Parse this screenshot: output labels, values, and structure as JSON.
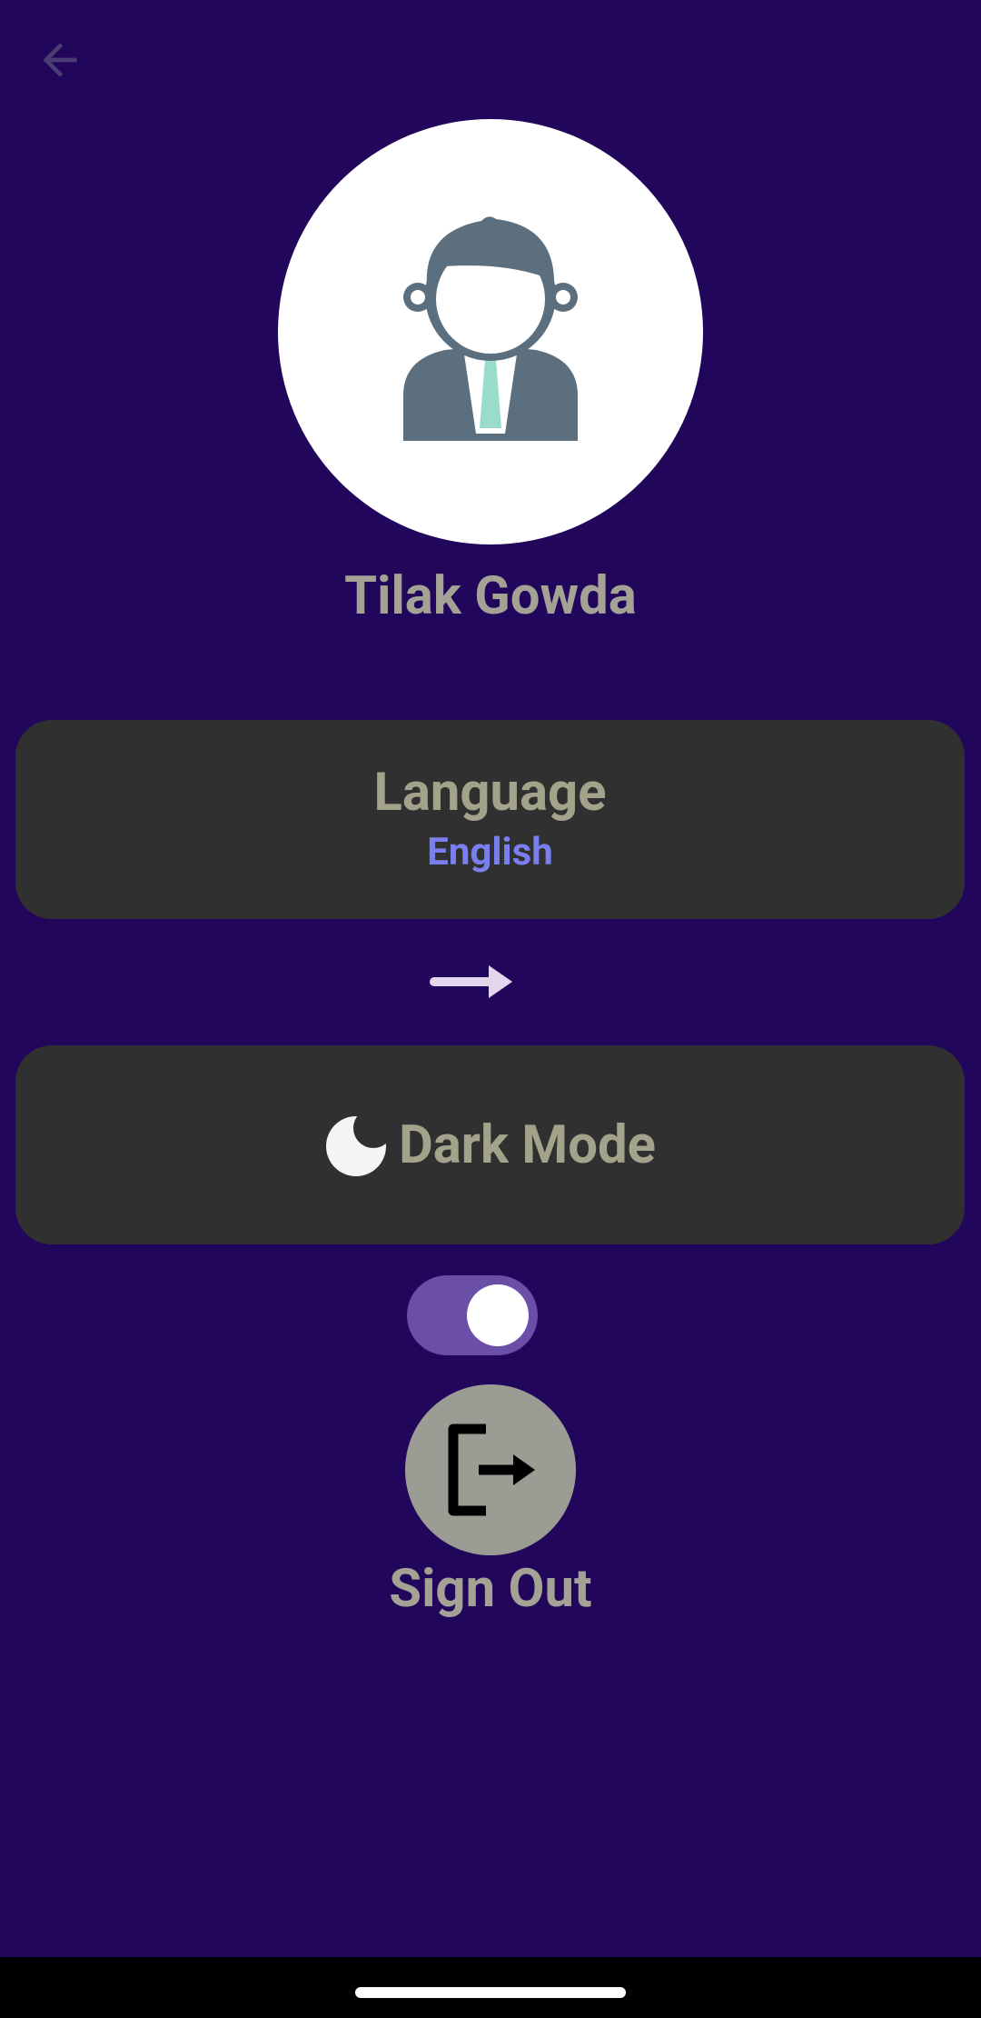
{
  "profile": {
    "name": "Tilak Gowda"
  },
  "language": {
    "title": "Language",
    "value": "English"
  },
  "dark_mode": {
    "title": "Dark Mode",
    "enabled": true
  },
  "sign_out": {
    "label": "Sign Out"
  },
  "icons": {
    "back": "arrow-left-icon",
    "avatar": "businessman-avatar-icon",
    "arrow": "arrow-right-icon",
    "moon": "moon-icon",
    "logout": "logout-icon"
  },
  "colors": {
    "background": "#22065c",
    "card": "#303030",
    "title_text": "#a3a38b",
    "accent_text": "#7a7ff0",
    "toggle_track": "#6a4ea7",
    "signout_circle": "#9b9d94"
  }
}
